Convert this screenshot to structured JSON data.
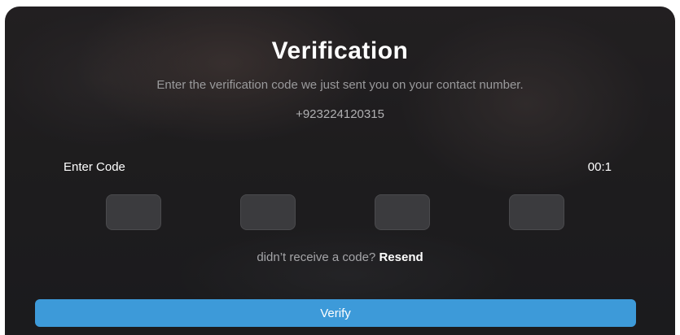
{
  "verification": {
    "title": "Verification",
    "subtitle": "Enter the verification code we just sent you on your contact number.",
    "phone_number": "+923224120315",
    "code_label": "Enter Code",
    "timer": "00:1",
    "code_digits": [
      "",
      "",
      "",
      ""
    ],
    "resend_prompt": "didn’t receive a code?",
    "resend_label": "Resend",
    "verify_label": "Verify"
  },
  "colors": {
    "accent": "#3d9ad9",
    "input_bg": "#3b3b3e",
    "background": "#242223"
  }
}
